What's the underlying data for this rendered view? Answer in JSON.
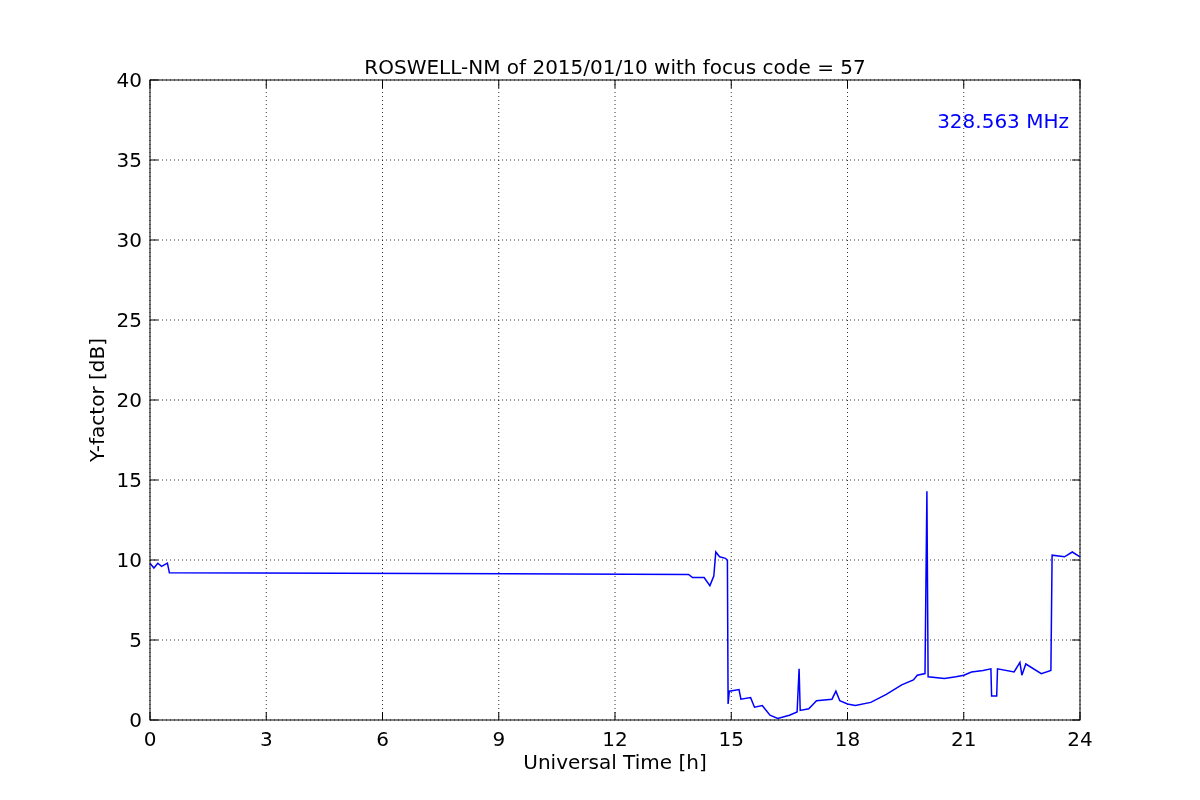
{
  "chart_data": {
    "type": "line",
    "title": "ROSWELL-NM of 2015/01/10 with focus code = 57",
    "xlabel": "Universal Time [h]",
    "ylabel": "Y-factor [dB]",
    "x": [
      0,
      0.1,
      0.2,
      0.3,
      0.45,
      0.5,
      13.9,
      14.0,
      14.3,
      14.45,
      14.55,
      14.6,
      14.7,
      14.85,
      14.9,
      14.92,
      14.95,
      15.2,
      15.25,
      15.5,
      15.6,
      15.8,
      16.0,
      16.2,
      16.5,
      16.7,
      16.75,
      16.78,
      17.0,
      17.2,
      17.6,
      17.7,
      17.8,
      18.0,
      18.2,
      18.6,
      19.0,
      19.4,
      19.7,
      19.8,
      20.0,
      20.05,
      20.08,
      20.5,
      20.8,
      21.0,
      21.2,
      21.5,
      21.7,
      21.72,
      21.85,
      21.87,
      22.3,
      22.45,
      22.5,
      22.6,
      23.0,
      23.25,
      23.28,
      23.6,
      23.8,
      24
    ],
    "series": [
      {
        "color": "#0000ff",
        "values": [
          9.8,
          9.5,
          9.8,
          9.6,
          9.8,
          9.2,
          9.1,
          8.9,
          8.9,
          8.4,
          9.0,
          10.5,
          10.2,
          10.1,
          10.0,
          1.0,
          1.8,
          1.9,
          1.3,
          1.4,
          0.8,
          0.9,
          0.3,
          0.1,
          0.3,
          0.5,
          3.2,
          0.6,
          0.7,
          1.2,
          1.3,
          1.8,
          1.2,
          1.0,
          0.9,
          1.1,
          1.6,
          2.2,
          2.5,
          2.8,
          2.9,
          14.3,
          2.7,
          2.6,
          2.7,
          2.8,
          3.0,
          3.1,
          3.2,
          1.5,
          1.5,
          3.2,
          3.0,
          3.6,
          2.8,
          3.5,
          2.9,
          3.1,
          10.3,
          10.2,
          10.5,
          10.2
        ]
      }
    ],
    "xlim": [
      0,
      24
    ],
    "ylim": [
      0,
      40
    ],
    "xticks": [
      0,
      3,
      6,
      9,
      12,
      15,
      18,
      21,
      24
    ],
    "yticks": [
      0,
      5,
      10,
      15,
      20,
      25,
      30,
      35,
      40
    ],
    "grid": true,
    "annotations": [
      "328.563 MHz"
    ]
  }
}
